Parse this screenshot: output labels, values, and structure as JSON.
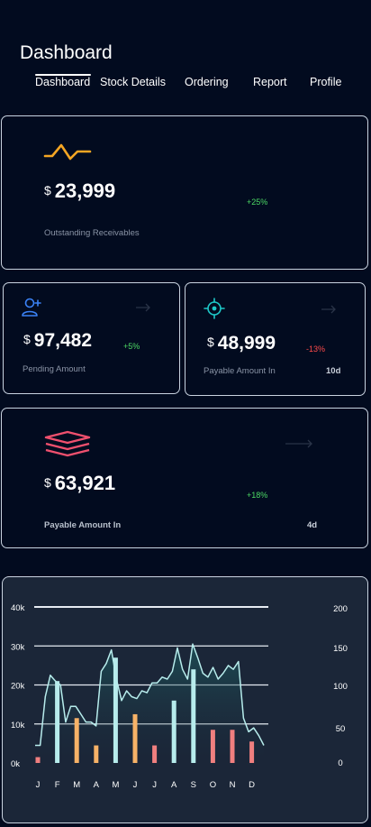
{
  "header": {
    "title": "Dashboard"
  },
  "tabs": [
    {
      "label": "Dashboard",
      "active": true
    },
    {
      "label": "Stock Details"
    },
    {
      "label": "Ordering"
    },
    {
      "label": "Report"
    },
    {
      "label": "Profile"
    }
  ],
  "cards": {
    "receivables": {
      "icon": "wave-icon",
      "currency": "$",
      "amount": "23,999",
      "change": "+25%",
      "label": "Outstanding Receivables",
      "accent": "#f5a623"
    },
    "pending": {
      "icon": "add-user-icon",
      "currency": "$",
      "amount": "97,482",
      "change": "+5%",
      "label": "Pending Amount",
      "accent": "#3b82f6"
    },
    "payable_small": {
      "icon": "target-icon",
      "currency": "$",
      "amount": "48,999",
      "change": "-13%",
      "label": "Payable Amount In",
      "days": "10d",
      "accent": "#1ec8c8"
    },
    "payable_large": {
      "icon": "layers-icon",
      "currency": "$",
      "amount": "63,921",
      "change": "+18%",
      "label": "Payable Amount In",
      "days": "4d",
      "accent": "#f0506e"
    }
  },
  "colors": {
    "background": "#020b1f",
    "positive": "#4cd964",
    "negative": "#ff4b4b",
    "chart_bg": "#1b2638"
  },
  "chart_data": {
    "type": "bar+area",
    "categories": [
      "J",
      "F",
      "M",
      "A",
      "M",
      "J",
      "J",
      "A",
      "S",
      "O",
      "N",
      "D"
    ],
    "left_axis": {
      "ticks": [
        "0k",
        "10k",
        "20k",
        "30k",
        "40k"
      ],
      "range": [
        0,
        40000
      ]
    },
    "right_axis": {
      "ticks": [
        "0",
        "50",
        "100",
        "150",
        "200"
      ],
      "range": [
        0,
        200
      ]
    },
    "bars": [
      {
        "x": "J",
        "value": 1500,
        "color": "#f07f7f"
      },
      {
        "x": "F",
        "value": 21000,
        "color": "#b7ecec"
      },
      {
        "x": "M",
        "value": 11500,
        "color": "#f7b267"
      },
      {
        "x": "A",
        "value": 4500,
        "color": "#f7b267"
      },
      {
        "x": "M",
        "value": 27000,
        "color": "#b7ecec"
      },
      {
        "x": "J",
        "value": 12500,
        "color": "#f7b267"
      },
      {
        "x": "J",
        "value": 4500,
        "color": "#f07f7f"
      },
      {
        "x": "A",
        "value": 16000,
        "color": "#b7ecec"
      },
      {
        "x": "S",
        "value": 24000,
        "color": "#b7ecec"
      },
      {
        "x": "O",
        "value": 8500,
        "color": "#f07f7f"
      },
      {
        "x": "N",
        "value": 8500,
        "color": "#f07f7f"
      },
      {
        "x": "D",
        "value": 5500,
        "color": "#f07f7f"
      }
    ],
    "area": [
      4500,
      4500,
      17000,
      22500,
      21000,
      20000,
      10500,
      14500,
      14500,
      12500,
      10500,
      10500,
      9500,
      23500,
      25500,
      29000,
      21500,
      16000,
      18500,
      17000,
      16500,
      18500,
      18000,
      20500,
      20500,
      22000,
      21500,
      23500,
      29500,
      24000,
      21500,
      30500,
      27000,
      23000,
      22000,
      24500,
      21500,
      23000,
      25000,
      24000,
      26000,
      11500,
      8000,
      9000,
      7000,
      4500
    ],
    "area_color": "#b7ecec",
    "grid": true
  }
}
